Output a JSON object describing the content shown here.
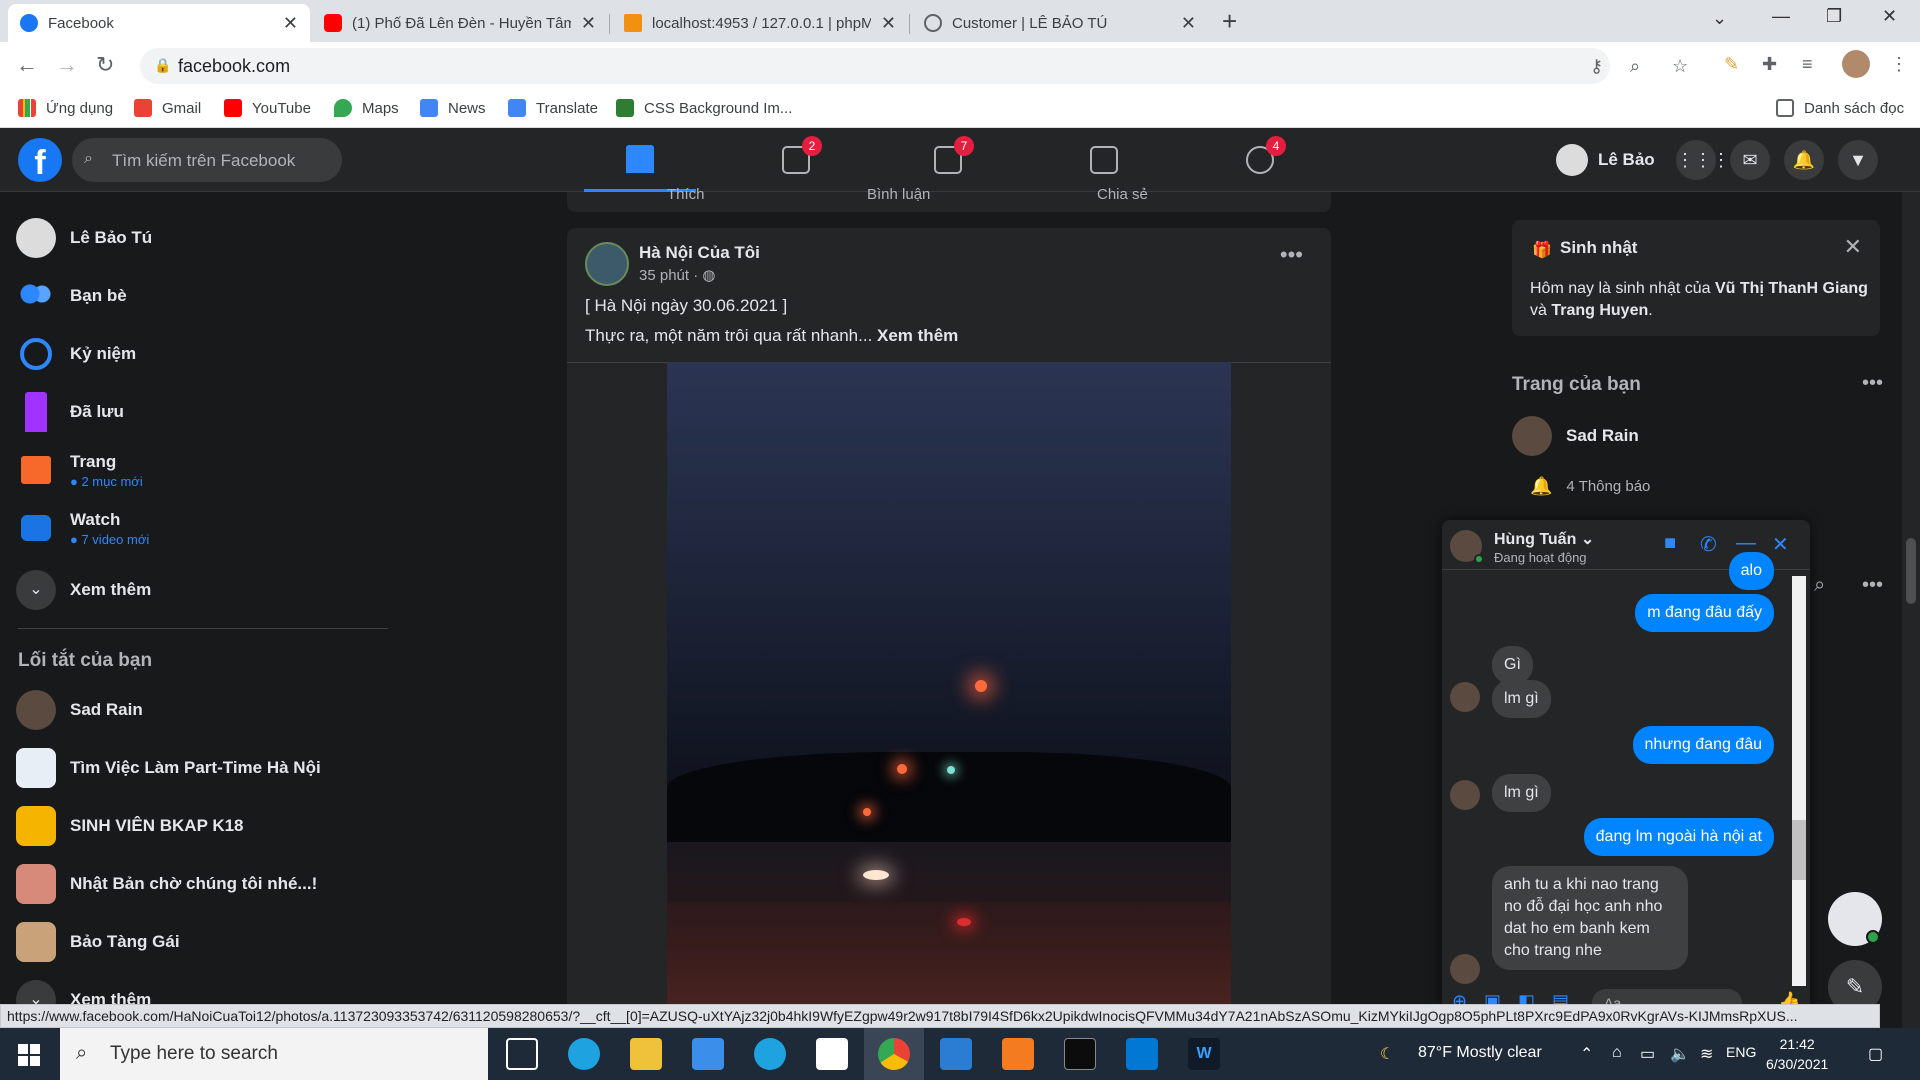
{
  "browser": {
    "tabs": [
      {
        "title": "Facebook",
        "favicon": "facebook-icon"
      },
      {
        "title": "(1) Phố Đã Lên Đèn - Huyền Tâm",
        "favicon": "youtube-icon"
      },
      {
        "title": "localhost:4953 / 127.0.0.1 | phpM",
        "favicon": "phpmyadmin-icon"
      },
      {
        "title": "Customer | LÊ BẢO TÚ",
        "favicon": "globe-icon"
      }
    ],
    "url": "facebook.com",
    "bookmarks": [
      {
        "label": "Ứng dụng"
      },
      {
        "label": "Gmail"
      },
      {
        "label": "YouTube"
      },
      {
        "label": "Maps"
      },
      {
        "label": "News"
      },
      {
        "label": "Translate"
      },
      {
        "label": "CSS Background Im..."
      }
    ],
    "reading_list": "Danh sách đọc",
    "status_url": "https://www.facebook.com/HaNoiCuaToi12/photos/a.113723093353742/631120598280653/?__cft__[0]=AZUSQ-uXtYAjz32j0b4hkI9WfyEZgpw49r2w917t8bI79I4SfD6kx2UpikdwInocisQFVMMu34dY7A21nAbSzASOmu_KizMYkiIJgOgp8O5phPLt8PXrc9EdPA9x0RvKgrAVs-KIJMmsRpXUS..."
  },
  "header": {
    "search_placeholder": "Tìm kiếm trên Facebook",
    "nav_badges": {
      "pages": "2",
      "watch": "7",
      "groups": "4"
    },
    "profile_name": "Lê Bảo"
  },
  "left": {
    "profile": "Lê Bảo Tú",
    "items": [
      {
        "label": "Bạn bè"
      },
      {
        "label": "Kỷ niệm"
      },
      {
        "label": "Đã lưu"
      },
      {
        "label": "Trang",
        "sub": "2 mục mới"
      },
      {
        "label": "Watch",
        "sub": "7 video mới"
      },
      {
        "label": "Xem thêm"
      }
    ],
    "shortcuts_heading": "Lối tắt của bạn",
    "shortcuts": [
      {
        "label": "Sad Rain"
      },
      {
        "label": "Tìm Việc Làm Part-Time Hà Nội"
      },
      {
        "label": "SINH VIÊN BKAP K18"
      },
      {
        "label": "Nhật Bản chờ chúng tôi nhé...!"
      },
      {
        "label": "Bảo Tàng Gái"
      },
      {
        "label": "Xem thêm"
      }
    ]
  },
  "prev_post_actions": [
    "Thích",
    "Bình luận",
    "Chia sẻ"
  ],
  "post": {
    "author": "Hà Nội Của Tôi",
    "time": "35 phút · ",
    "line1": "[ Hà Nội ngày 30.06.2021 ]",
    "line2": "Thực ra, một năm trôi qua rất nhanh... ",
    "see_more": "Xem thêm"
  },
  "right": {
    "birthday_title": "Sinh nhật",
    "birthday_prefix": "Hôm nay là sinh nhật của ",
    "birthday_name1": "Vũ Thị ThanH Giang",
    "birthday_and": " và ",
    "birthday_name2": "Trang Huyen",
    "birthday_end": ".",
    "pages_heading": "Trang của bạn",
    "page_name": "Sad Rain",
    "page_notif": "4 Thông báo"
  },
  "chat": {
    "name": "Hùng Tuấn",
    "status": "Đang hoạt động",
    "messages": [
      {
        "from": "me",
        "text": "alo"
      },
      {
        "from": "me",
        "text": "m đang đâu đấy"
      },
      {
        "from": "them",
        "text": "Gì"
      },
      {
        "from": "them",
        "text": "lm gì"
      },
      {
        "from": "me",
        "text": "nhưng đang đâu"
      },
      {
        "from": "them",
        "text": "lm gì"
      },
      {
        "from": "me",
        "text": "đang lm ngoài hà nội at"
      },
      {
        "from": "them",
        "text": "anh tu a khi nao trang no đỗ đại  học anh nho dat ho em banh kem cho trang nhe"
      }
    ],
    "input_placeholder": "Aa"
  },
  "taskbar": {
    "search_placeholder": "Type here to search",
    "weather": "87°F  Mostly clear",
    "lang": "ENG",
    "time": "21:42",
    "date": "6/30/2021"
  }
}
